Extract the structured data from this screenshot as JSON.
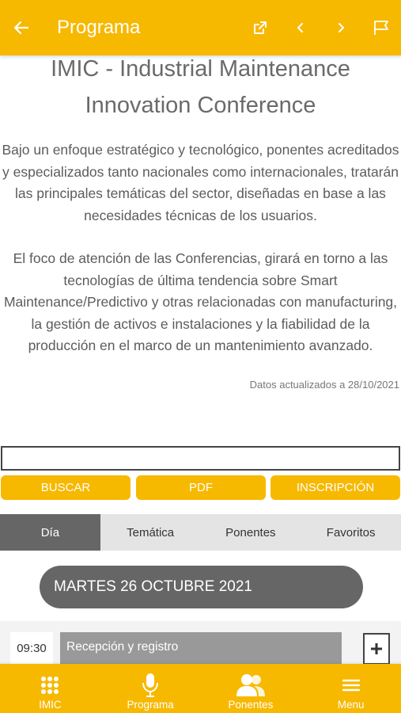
{
  "appbar": {
    "title": "Programa",
    "actions": [
      "external-link-icon",
      "chevron-left-icon",
      "chevron-right-icon",
      "flag-icon"
    ]
  },
  "event": {
    "title": "IMIC - Industrial Maintenance Innovation Conference",
    "paragraphs": [
      "Bajo un enfoque estratégico y tecnológico, ponentes acreditados y especializados tanto nacionales como internacionales, tratarán las principales temáticas del sector, diseñadas en base a las necesidades técnicas de los usuarios.",
      "El foco de atención de las Conferencias, girará en torno a las tecnologías de última tendencia sobre Smart Maintenance/Predictivo y otras relacionadas con manufacturing, la gestión de activos e instalaciones y la fiabilidad de la producción en el marco de un mantenimiento avanzado."
    ],
    "updated": "Datos actualizados a 28/10/2021"
  },
  "search": {
    "value": "",
    "placeholder": ""
  },
  "buttons": {
    "buscar": "BUSCAR",
    "pdf": "PDF",
    "inscripcion": "INSCRIPCIÓN"
  },
  "tabs": [
    {
      "label": "Día",
      "active": true
    },
    {
      "label": "Temática",
      "active": false
    },
    {
      "label": "Ponentes",
      "active": false
    },
    {
      "label": "Favoritos",
      "active": false
    }
  ],
  "day": {
    "label": "MARTES 26 OCTUBRE 2021"
  },
  "sessions": [
    {
      "time": "09:30",
      "title": "Recepción y registro"
    }
  ],
  "bottomnav": [
    {
      "label": "IMIC",
      "icon": "grid-icon"
    },
    {
      "label": "Programa",
      "icon": "microphone-icon"
    },
    {
      "label": "Ponentes",
      "icon": "people-icon"
    },
    {
      "label": "Menu",
      "icon": "hamburger-icon"
    }
  ],
  "colors": {
    "primary": "#f7b800",
    "tab_active": "#666666",
    "session_title": "#999999"
  }
}
